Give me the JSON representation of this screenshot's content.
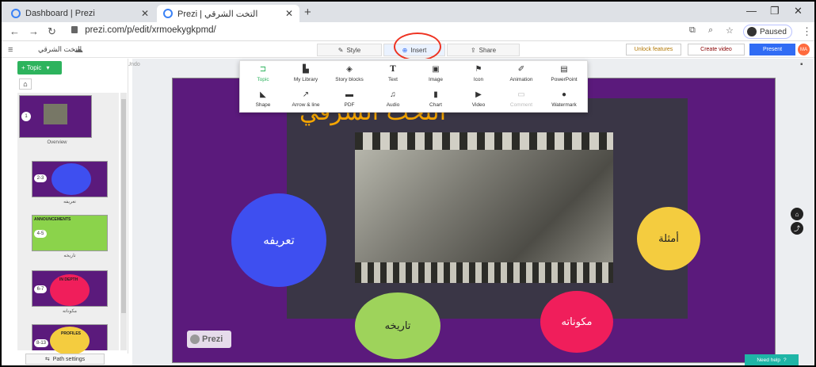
{
  "browser": {
    "tabs": [
      {
        "title": "Dashboard | Prezi"
      },
      {
        "title": "Prezi | التخت الشرقي"
      }
    ],
    "url": "prezi.com/p/edit/xrmoekygkpmd/",
    "profile_status": "Paused"
  },
  "app": {
    "presentation_title": "التخت الشرقي",
    "toolbar": {
      "style": "Style",
      "insert": "Insert",
      "share": "Share"
    },
    "right_buttons": {
      "unlock": "Unlock features",
      "create_video": "Create video",
      "present": "Present",
      "avatar_initials": "MA"
    },
    "undo": "Undo",
    "topic_button": "+ Topic",
    "path_settings": "Path settings",
    "need_help": "Need help"
  },
  "insert_menu": {
    "row1": [
      {
        "label": "Topic",
        "icon": "topic-icon",
        "glyph": "⊐",
        "active": true
      },
      {
        "label": "My Library",
        "icon": "library-icon",
        "glyph": "▙"
      },
      {
        "label": "Story blocks",
        "icon": "storyblocks-icon",
        "glyph": "◈"
      },
      {
        "label": "Text",
        "icon": "text-icon",
        "glyph": "T"
      },
      {
        "label": "Image",
        "icon": "image-icon",
        "glyph": "▣"
      },
      {
        "label": "Icon",
        "icon": "flag-icon",
        "glyph": "⚑"
      },
      {
        "label": "Animation",
        "icon": "wand-icon",
        "glyph": "✐"
      },
      {
        "label": "PowerPoint",
        "icon": "powerpoint-icon",
        "glyph": "▤"
      }
    ],
    "row2": [
      {
        "label": "Shape",
        "icon": "shape-icon",
        "glyph": "◣"
      },
      {
        "label": "Arrow & line",
        "icon": "arrow-icon",
        "glyph": "↗"
      },
      {
        "label": "PDF",
        "icon": "pdf-icon",
        "glyph": "▬"
      },
      {
        "label": "Audio",
        "icon": "audio-icon",
        "glyph": "♫"
      },
      {
        "label": "Chart",
        "icon": "chart-icon",
        "glyph": "▮"
      },
      {
        "label": "Video",
        "icon": "video-icon",
        "glyph": "▶"
      },
      {
        "label": "Comment",
        "icon": "comment-icon",
        "glyph": "▭",
        "disabled": true
      },
      {
        "label": "Watermark",
        "icon": "watermark-icon",
        "glyph": "●"
      }
    ]
  },
  "thumbnails": [
    {
      "badge": "1",
      "label": "Overview",
      "bg": "#5b1a7c"
    },
    {
      "badge": "2-3",
      "label": "تعريفه",
      "bg": "#3e4ff0"
    },
    {
      "badge": "4-5",
      "label": "تاريخه",
      "bg": "#8bd34b",
      "heading": "ANNOUNCEMENTS"
    },
    {
      "badge": "6-7",
      "label": "مكوناته",
      "bg": "#5b1a7c",
      "heading": "IN DEPTH"
    },
    {
      "badge": "8-13",
      "label": "",
      "bg": "#5b1a7c",
      "heading": "PROFILES"
    }
  ],
  "slide": {
    "title": "التخت الشرقي",
    "circles": {
      "definition": "تعريفه",
      "examples": "أمثلة",
      "history": "تاريخه",
      "components": "مكوناته"
    },
    "logo": "Prezi"
  },
  "colors": {
    "accent_green": "#2db35d",
    "present_blue": "#316cf4",
    "slide_purple": "#5b1a7c",
    "title_orange": "#f6a600"
  }
}
